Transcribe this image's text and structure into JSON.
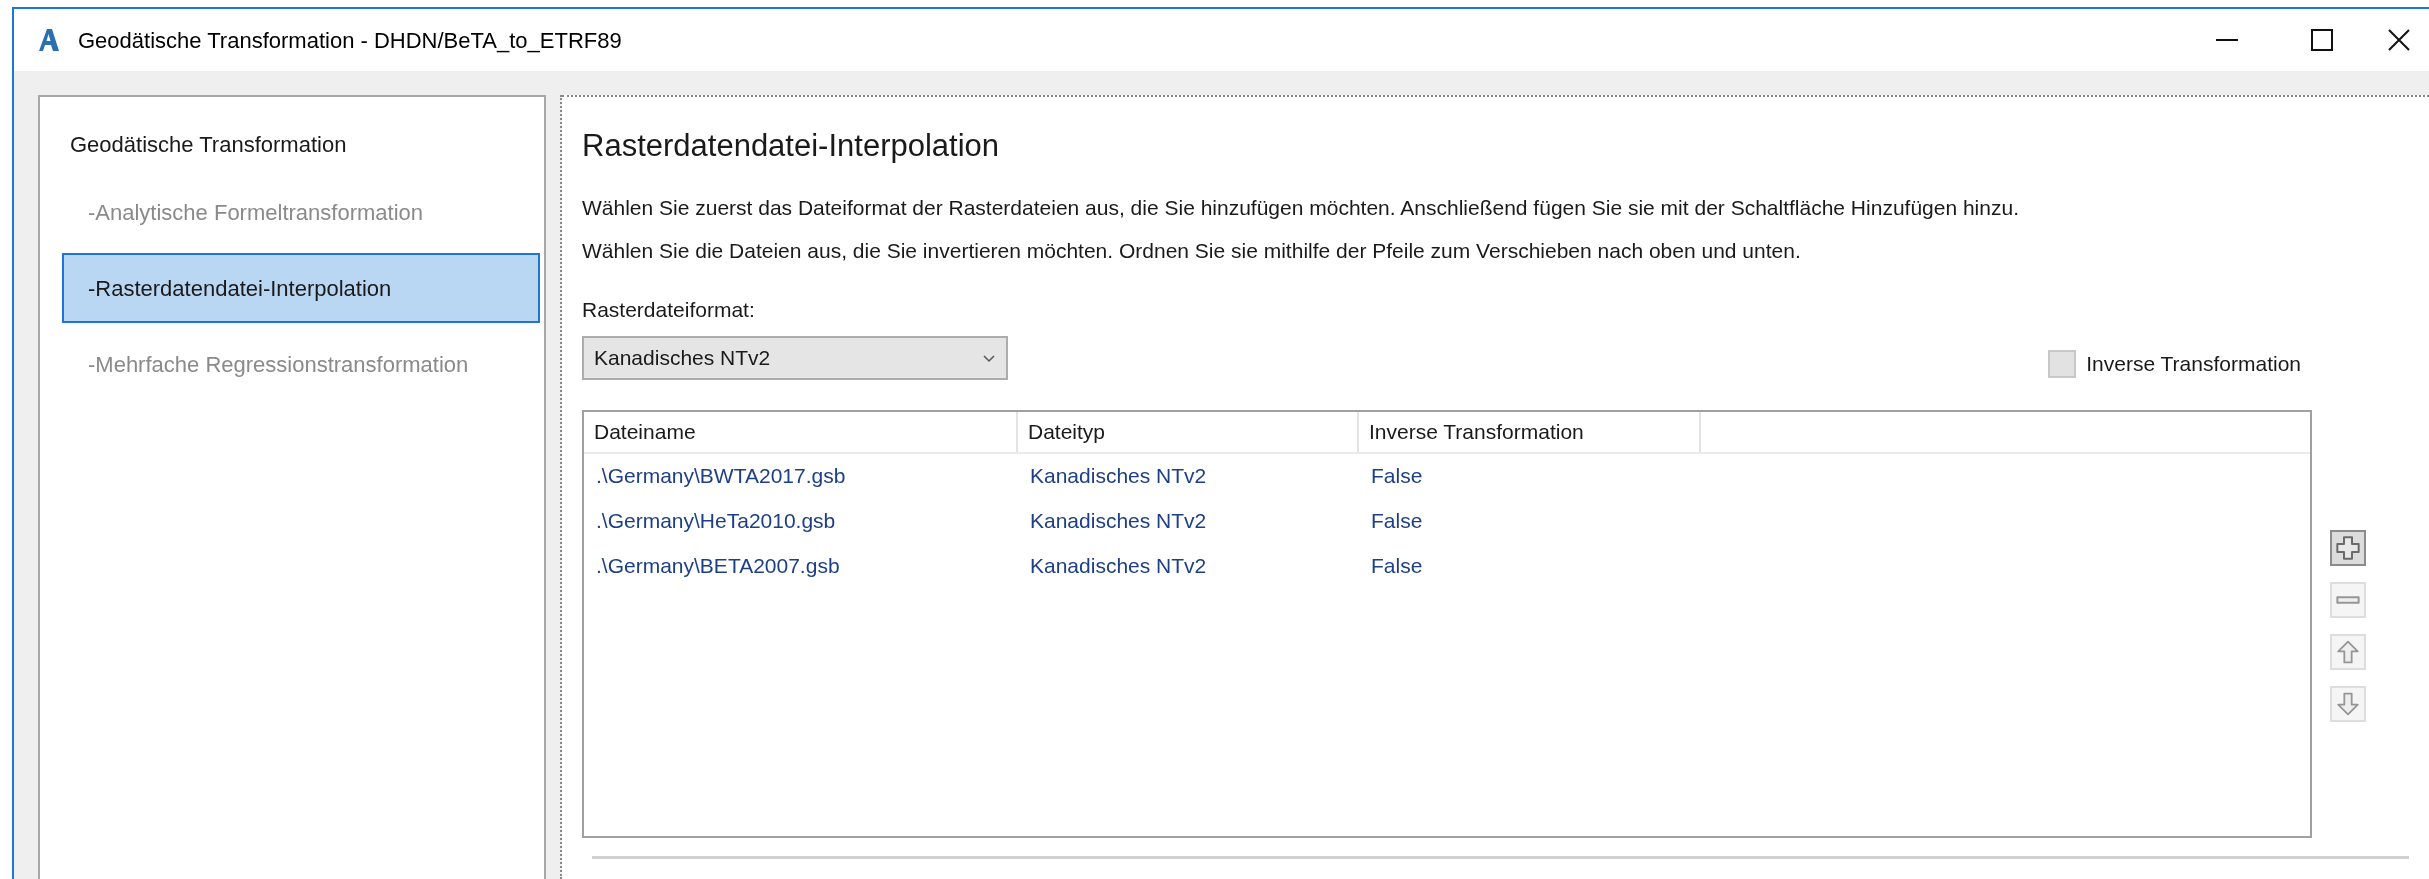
{
  "window": {
    "title": "Geodätische Transformation - DHDN/BeTA_to_ETRF89"
  },
  "sidebar": {
    "items": [
      {
        "label": "Geodätische Transformation",
        "selected": false,
        "disabled": false,
        "children": [
          {
            "label": "-Analytische Formeltransformation",
            "selected": false,
            "disabled": true
          },
          {
            "label": "-Rasterdatendatei-Interpolation",
            "selected": true,
            "disabled": false
          },
          {
            "label": "-Mehrfache Regressionstransformation",
            "selected": false,
            "disabled": true
          }
        ]
      }
    ]
  },
  "content": {
    "heading": "Rasterdatendatei-Interpolation",
    "description": [
      "Wählen Sie zuerst das Dateiformat der Rasterdateien aus, die Sie hinzufügen möchten. Anschließend fügen Sie sie mit der Schaltfläche Hinzufügen hinzu.",
      "Wählen Sie die Dateien aus, die Sie invertieren möchten. Ordnen Sie sie mithilfe der Pfeile zum Verschieben nach oben und unten."
    ],
    "format_label": "Rasterdateiformat:",
    "format_select": {
      "value": "Kanadisches NTv2"
    },
    "inverse_checkbox": {
      "label": "Inverse Transformation",
      "checked": false
    },
    "table": {
      "columns": [
        "Dateiname",
        "Dateityp",
        "Inverse Transformation"
      ],
      "rows": [
        [
          ".\\Germany\\BWTA2017.gsb",
          "Kanadisches NTv2",
          "False"
        ],
        [
          ".\\Germany\\HeTa2010.gsb",
          "Kanadisches NTv2",
          "False"
        ],
        [
          ".\\Germany\\BETA2007.gsb",
          "Kanadisches NTv2",
          "False"
        ]
      ]
    },
    "side_buttons": [
      {
        "kind": "add",
        "disabled": false
      },
      {
        "kind": "remove",
        "disabled": true
      },
      {
        "kind": "up",
        "disabled": true
      },
      {
        "kind": "down",
        "disabled": true
      }
    ]
  }
}
